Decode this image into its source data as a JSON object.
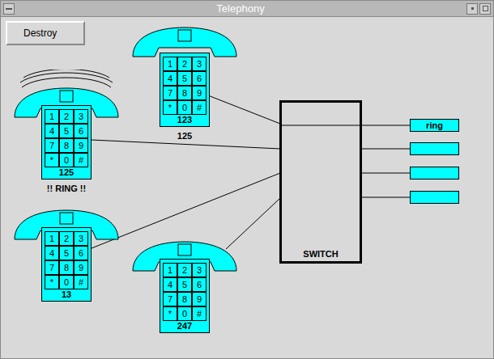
{
  "window": {
    "title": "Telephony"
  },
  "buttons": [
    "Destroy"
  ],
  "keypad": [
    "1",
    "2",
    "3",
    "4",
    "5",
    "6",
    "7",
    "8",
    "9",
    "*",
    "0",
    "#"
  ],
  "phones": [
    {
      "display": "123",
      "label": "125",
      "off_hook": true,
      "ringing": false
    },
    {
      "display": "125",
      "label": "!! RING !!",
      "off_hook": false,
      "ringing": true
    },
    {
      "display": "13",
      "label": "",
      "off_hook": false,
      "ringing": false
    },
    {
      "display": "247",
      "label": "",
      "off_hook": false,
      "ringing": false
    }
  ],
  "switch": {
    "label": "SWITCH"
  },
  "lines": [
    {
      "status": "ring",
      "connected": true
    },
    {
      "status": "",
      "connected": false
    },
    {
      "status": "",
      "connected": false
    },
    {
      "status": "",
      "connected": false
    }
  ]
}
